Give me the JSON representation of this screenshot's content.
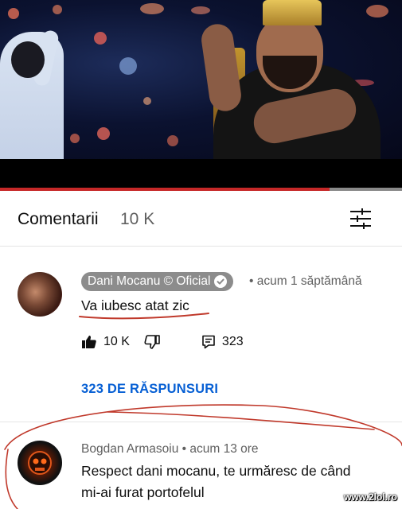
{
  "video": {
    "progress_fraction": 0.82,
    "accent_color": "#c62828"
  },
  "comments_header": {
    "title": "Comentarii",
    "count": "10 K",
    "sort_icon": "sort-filter-icon"
  },
  "comment_1": {
    "author": "Dani Mocanu © Oficial",
    "verified": true,
    "time": "• acum 1 săptămână",
    "text": "Va iubesc atat zic",
    "likes": "10 K",
    "replies_count": "323",
    "replies_link": "323 DE RĂSPUNSURI",
    "avatar_icon": "avatar"
  },
  "comment_2": {
    "author_line": "Bogdan Armasoiu • acum 13 ore",
    "text_line1": "Respect dani mocanu, te urmăresc de când",
    "text_line2": "mi-ai furat portofelul"
  },
  "watermark": "www.2lol.ro",
  "colors": {
    "link": "#065fd4",
    "secondary_text": "#606060",
    "owner_chip": "#8c8c8c",
    "annotation_red": "#c0392b"
  }
}
